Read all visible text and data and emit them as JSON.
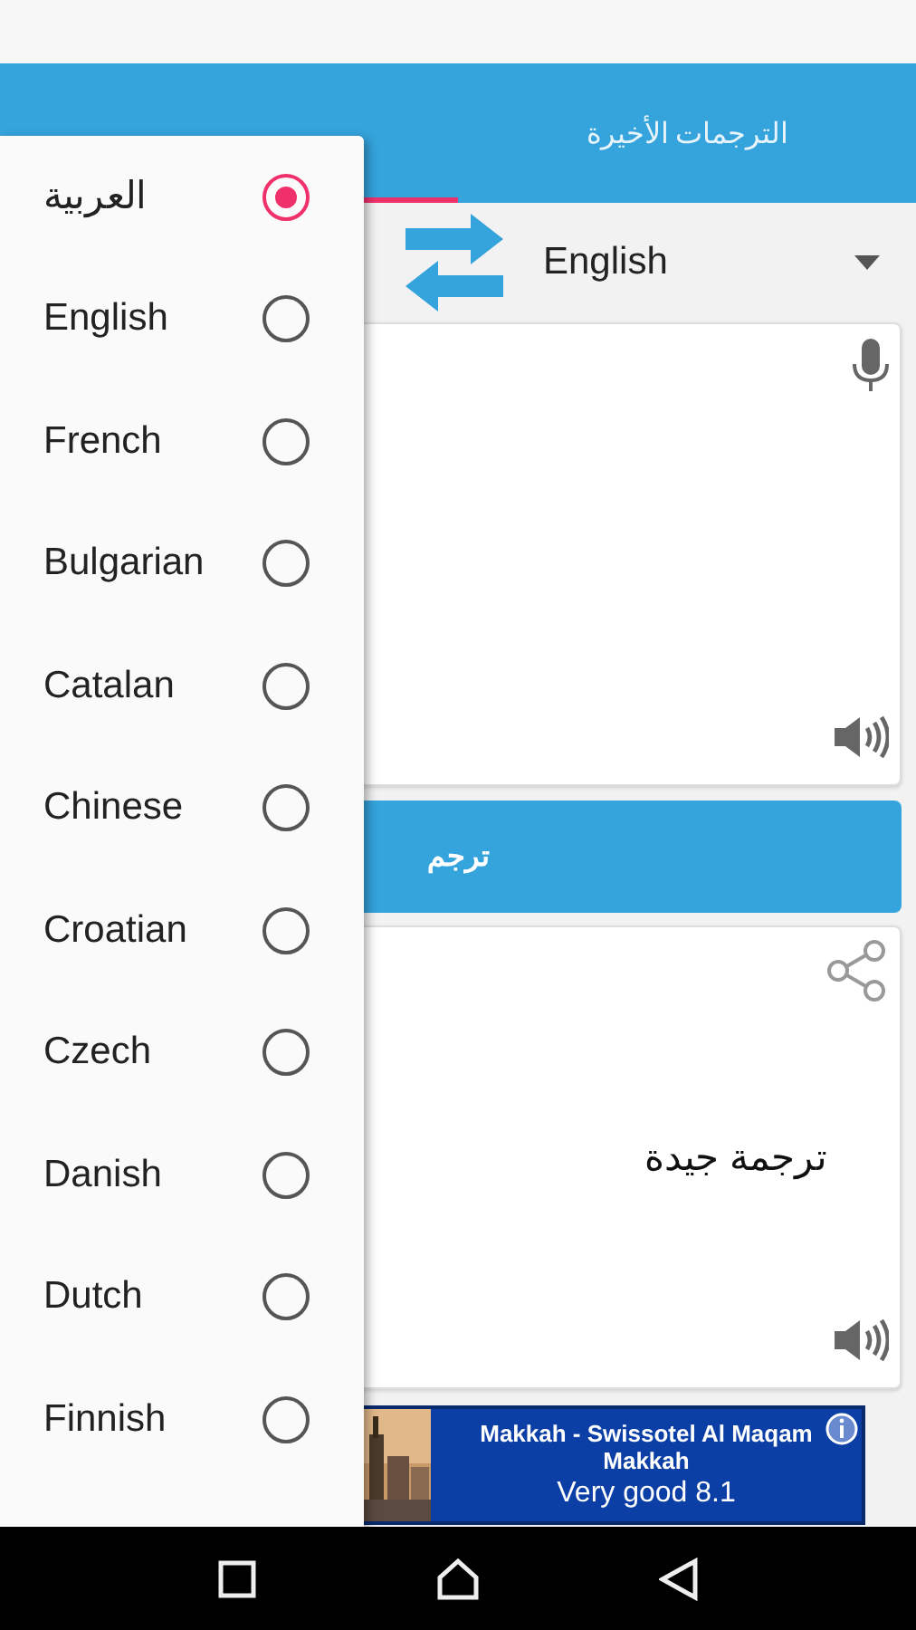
{
  "tabs": [
    {
      "selected": true
    },
    {
      "label": "الترجمات الأخيرة",
      "selected": false
    }
  ],
  "target_language": "English",
  "translate_button": "ترجم",
  "output": {
    "text": "ترجمة جيدة"
  },
  "ad": {
    "title": "Makkah - Swissotel Al Maqam Makkah",
    "rating": "Very good 8.1"
  },
  "language_menu": {
    "items": [
      {
        "label": "العربية",
        "selected": true
      },
      {
        "label": "English",
        "selected": false
      },
      {
        "label": "French",
        "selected": false
      },
      {
        "label": "Bulgarian",
        "selected": false
      },
      {
        "label": "Catalan",
        "selected": false
      },
      {
        "label": "Chinese",
        "selected": false
      },
      {
        "label": "Croatian",
        "selected": false
      },
      {
        "label": "Czech",
        "selected": false
      },
      {
        "label": "Danish",
        "selected": false
      },
      {
        "label": "Dutch",
        "selected": false
      },
      {
        "label": "Finnish",
        "selected": false
      }
    ]
  }
}
